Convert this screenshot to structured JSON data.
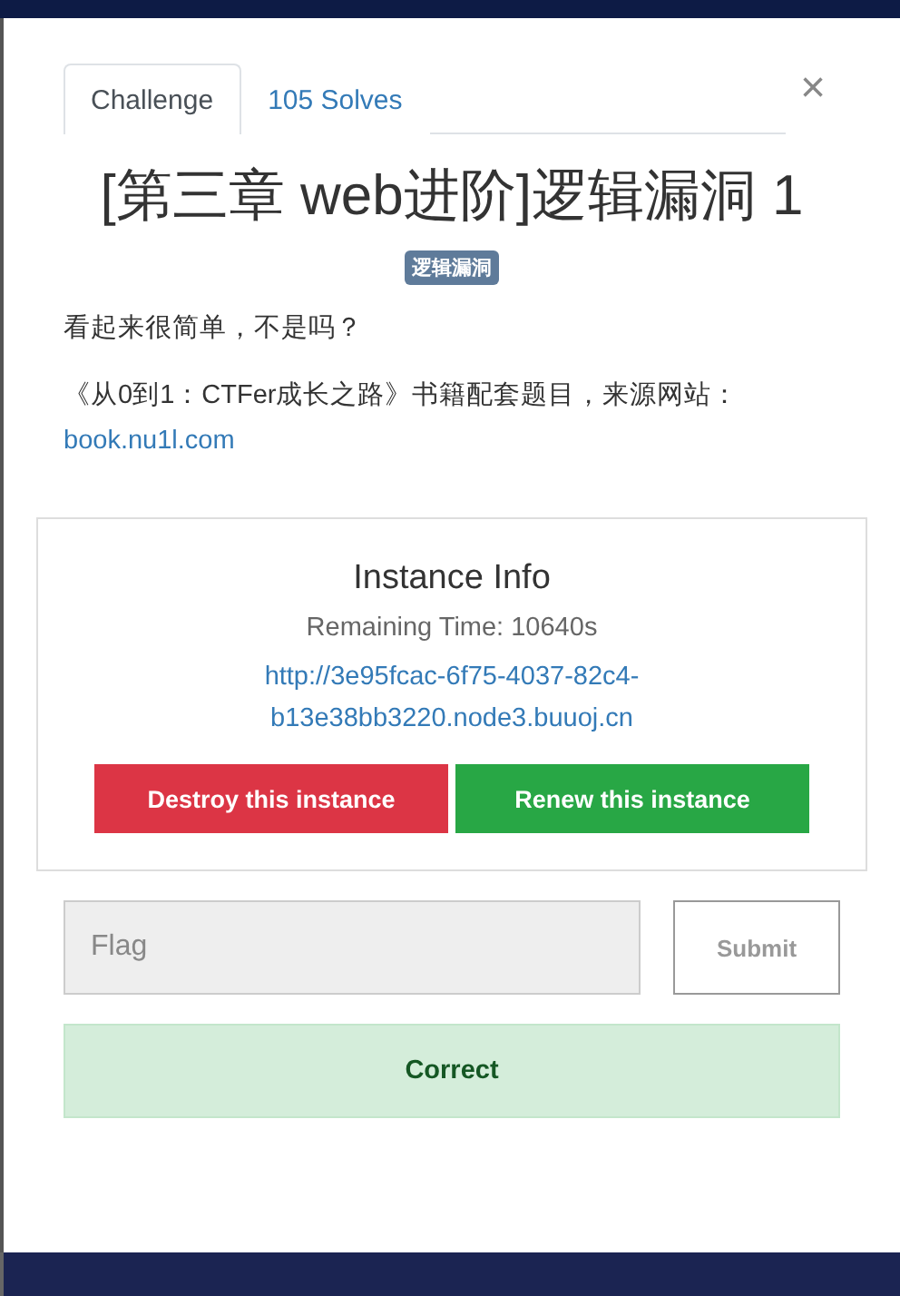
{
  "tabs": [
    {
      "label": "Challenge",
      "selected": true
    },
    {
      "label": "105 Solves",
      "selected": false
    }
  ],
  "close": "×",
  "title": "[第三章 web进阶]逻辑漏洞 1",
  "tags": [
    "逻辑漏洞"
  ],
  "description": [
    "看起来很简单，不是吗？",
    "《从0到1：CTFer成长之路》书籍配套题目，来源网站："
  ],
  "description_link": "book.nu1l.com",
  "instance": {
    "heading": "Instance Info",
    "remaining": "Remaining Time: 10640s",
    "url": "http://3e95fcac-6f75-4037-82c4-b13e38bb3220.node3.buuoj.cn",
    "buttons": [
      {
        "label": "Destroy this instance",
        "kind": "danger"
      },
      {
        "label": "Renew this instance",
        "kind": "success"
      }
    ]
  },
  "flag": {
    "placeholder": "Flag",
    "submit": "Submit"
  },
  "result": {
    "text": "Correct"
  }
}
